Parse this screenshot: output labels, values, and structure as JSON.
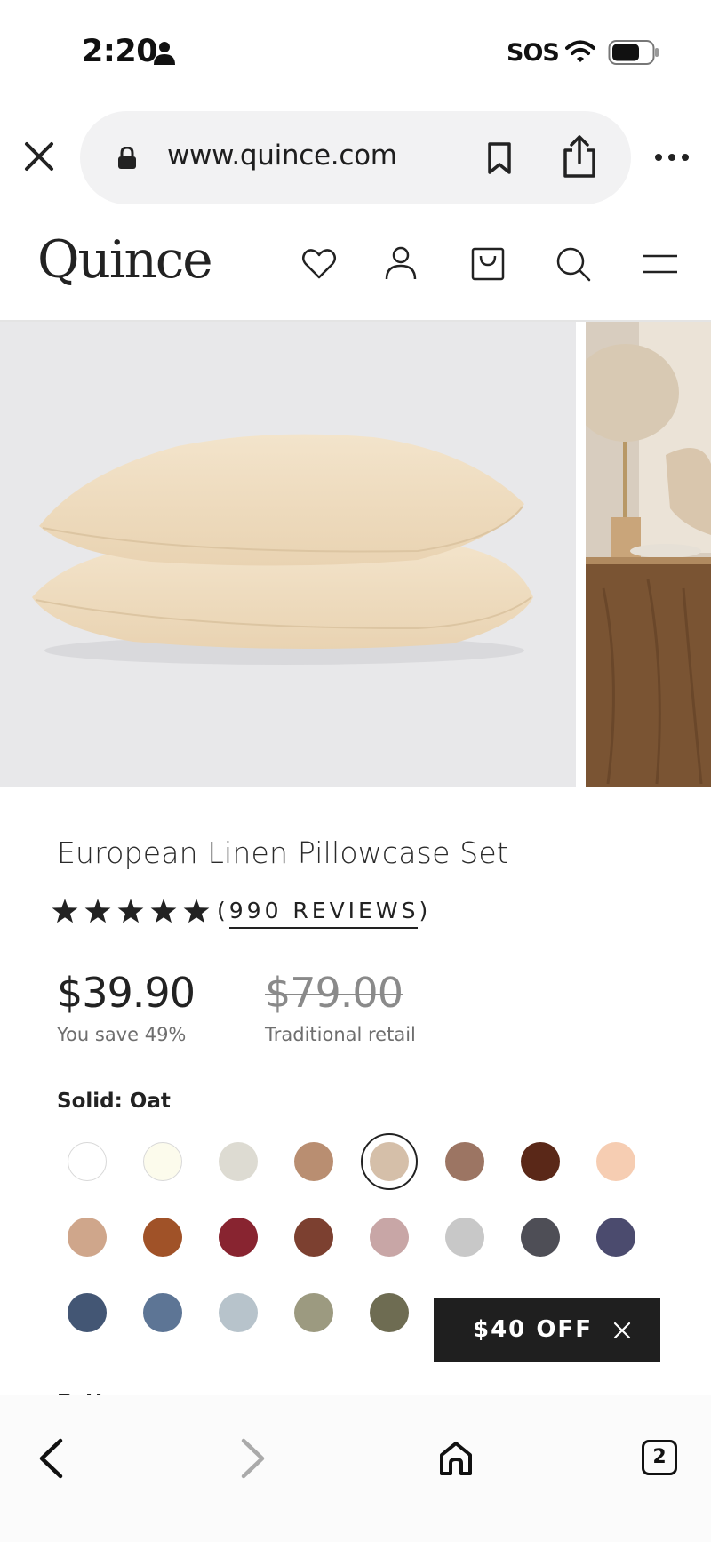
{
  "status_bar": {
    "time": "2:20",
    "carrier": "SOS"
  },
  "browser": {
    "url": "www.quince.com"
  },
  "site": {
    "logo": "Quince"
  },
  "product": {
    "title": "European Linen Pillowcase Set",
    "rating": 5,
    "reviews_label": "(990 REVIEWS)",
    "price": "$39.90",
    "savings": "You save 49%",
    "retail_price": "$79.00",
    "retail_label": "Traditional retail",
    "color_label": "Solid: Oat",
    "pattern_label": "Pattern:",
    "swatches": [
      {
        "name": "white",
        "color": "#ffffff"
      },
      {
        "name": "ivory",
        "color": "#fcfbec"
      },
      {
        "name": "light-grey",
        "color": "#dddbd2"
      },
      {
        "name": "terracotta-light",
        "color": "#b98e71"
      },
      {
        "name": "oat",
        "color": "#d5bfa9",
        "selected": true
      },
      {
        "name": "mocha",
        "color": "#9c7563"
      },
      {
        "name": "chocolate",
        "color": "#5a2818"
      },
      {
        "name": "peach",
        "color": "#f6cdb2"
      },
      {
        "name": "sand",
        "color": "#cfa68b"
      },
      {
        "name": "rust",
        "color": "#a05228"
      },
      {
        "name": "crimson",
        "color": "#882430"
      },
      {
        "name": "brick",
        "color": "#7c4030"
      },
      {
        "name": "mauve",
        "color": "#c8a6a6"
      },
      {
        "name": "silver",
        "color": "#c8c8c8"
      },
      {
        "name": "charcoal",
        "color": "#4e4e56"
      },
      {
        "name": "navy-purple",
        "color": "#4b4b6e"
      },
      {
        "name": "navy",
        "color": "#435674"
      },
      {
        "name": "blue",
        "color": "#5d7595"
      },
      {
        "name": "light-blue",
        "color": "#b7c3cb"
      },
      {
        "name": "sage",
        "color": "#9c9a80"
      },
      {
        "name": "olive",
        "color": "#6e6c52"
      }
    ]
  },
  "promo": {
    "label": "$40 OFF"
  },
  "bottom_nav": {
    "tab_count": "2"
  }
}
